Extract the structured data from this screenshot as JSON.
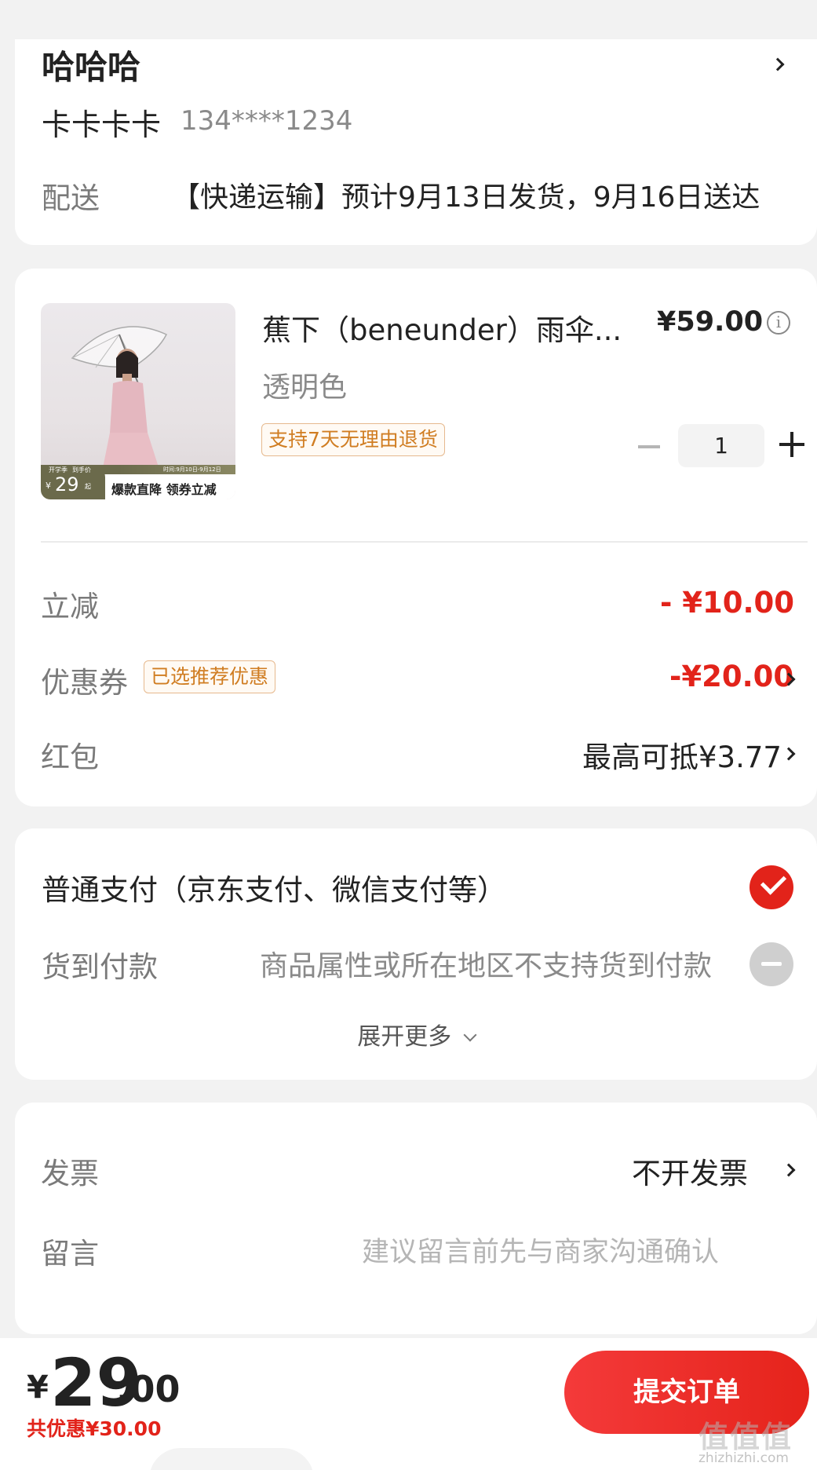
{
  "address": {
    "name": "哈哈哈",
    "receiver": "卡卡卡卡",
    "phone": "134****1234",
    "delivery_label": "配送",
    "delivery_text": "【快递运输】预计9月13日发货，9月16日送达"
  },
  "product": {
    "title": "蕉下（beneunder）雨伞...",
    "price": "¥59.00",
    "variant": "透明色",
    "return_tag": "支持7天无理由退货",
    "quantity": "1",
    "image_banner": {
      "tag1": "开学季",
      "tag2": "到手价",
      "price_prefix": "¥",
      "price": "29",
      "price_suffix": "起",
      "time": "时间:9月10日-9月12日",
      "slogan": "爆款直降 领券立减"
    }
  },
  "discounts": {
    "instant_label": "立减",
    "instant_value": "- ¥10.00",
    "coupon_label": "优惠券",
    "coupon_tag": "已选推荐优惠",
    "coupon_value": "-¥20.00",
    "redpacket_label": "红包",
    "redpacket_value": "最高可抵¥3.77"
  },
  "payment": {
    "option1": "普通支付（京东支付、微信支付等）",
    "option2_label": "货到付款",
    "option2_note": "商品属性或所在地区不支持货到付款",
    "expand": "展开更多"
  },
  "invoice": {
    "label": "发票",
    "value": "不开发票",
    "message_label": "留言",
    "message_placeholder": "建议留言前先与商家沟通确认"
  },
  "bottom": {
    "currency": "¥",
    "total_int": "29",
    "total_dec": ".00",
    "saved": "共优惠¥30.00",
    "submit": "提交订单",
    "watermark": "值值值",
    "watermark_url": "zhizhizhi.com"
  },
  "colors": {
    "accent": "#e2231a",
    "tag": "#d07d22"
  }
}
